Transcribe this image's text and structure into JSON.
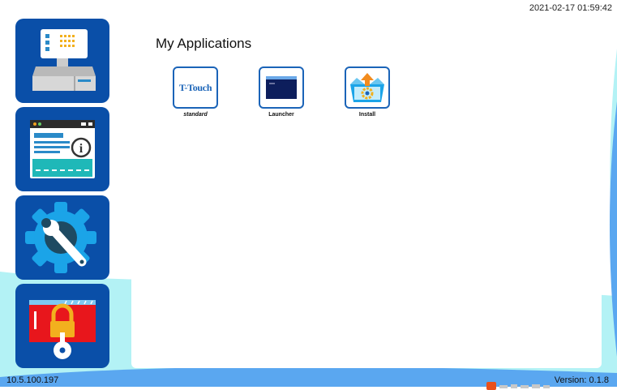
{
  "header": {
    "datetime": "2021-02-17 01:59:42"
  },
  "sidebar": {
    "items": [
      {
        "name": "device"
      },
      {
        "name": "info"
      },
      {
        "name": "settings"
      },
      {
        "name": "security"
      }
    ]
  },
  "main": {
    "title": "My Applications",
    "apps": [
      {
        "label": "standard",
        "icon_text": "T-Touch"
      },
      {
        "label": "Launcher"
      },
      {
        "label": "Install"
      }
    ]
  },
  "footer": {
    "ip": "10.5.100.197",
    "version": "Version: 0.1.8"
  },
  "colors": {
    "sidebar_button": "#0a4fa8",
    "background_light": "#b3f2f5",
    "background_blue": "#5aa7f0",
    "app_border": "#1b64b8"
  }
}
